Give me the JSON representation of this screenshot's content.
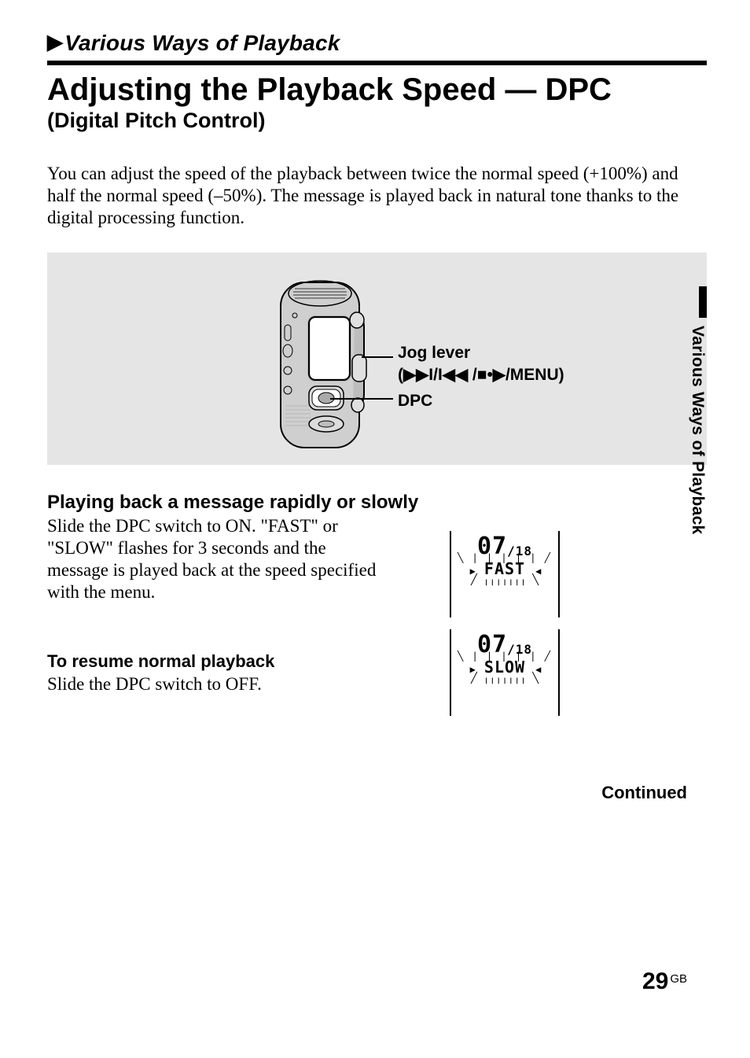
{
  "kicker": {
    "arrow": "▶",
    "text": "Various Ways of Playback"
  },
  "title_main": "Adjusting the Playback Speed — DPC",
  "title_sub": "(Digital Pitch Control)",
  "intro": "You can adjust the speed of the playback between twice the normal speed (+100%) and half the normal speed (–50%).  The message is played back in natural tone thanks to the digital processing function.",
  "illustration": {
    "label_jog": "Jog lever",
    "label_jog_symbols": "(▶▶I/I◀◀ /■•▶/MENU)",
    "label_dpc": "DPC"
  },
  "sidetab": "Various Ways of Playback",
  "section1": {
    "heading": "Playing back a message rapidly or slowly",
    "body": "Slide the DPC switch to ON. \"FAST\" or \"SLOW\" flashes for 3 seconds and the message is played back at the speed specified with the menu."
  },
  "lcd1": {
    "top": "07",
    "top_small": "/18",
    "text": "FAST"
  },
  "lcd2": {
    "top": "07",
    "top_small": "/18",
    "text": "SLOW"
  },
  "section2": {
    "heading": "To resume normal playback",
    "body": "Slide the DPC switch to OFF."
  },
  "continued": "Continued",
  "page": {
    "num": "29",
    "suffix": "GB"
  }
}
